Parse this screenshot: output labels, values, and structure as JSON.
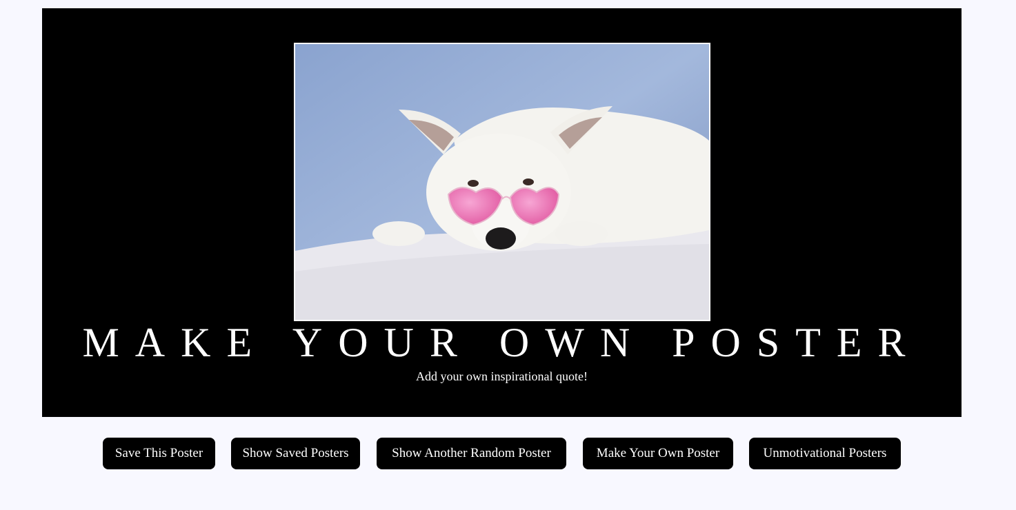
{
  "poster": {
    "title": "MAKE YOUR OWN POSTER",
    "quote": "Add your own inspirational quote!"
  },
  "buttons": {
    "save": "Save This Poster",
    "show_saved": "Show Saved Posters",
    "random": "Show Another Random Poster",
    "make_own": "Make Your Own Poster",
    "unmotivational": "Unmotivational Posters"
  },
  "colors": {
    "page_background": "#f8f8ff",
    "poster_background": "#000000",
    "button_background": "#000000",
    "text": "#ffffff"
  }
}
